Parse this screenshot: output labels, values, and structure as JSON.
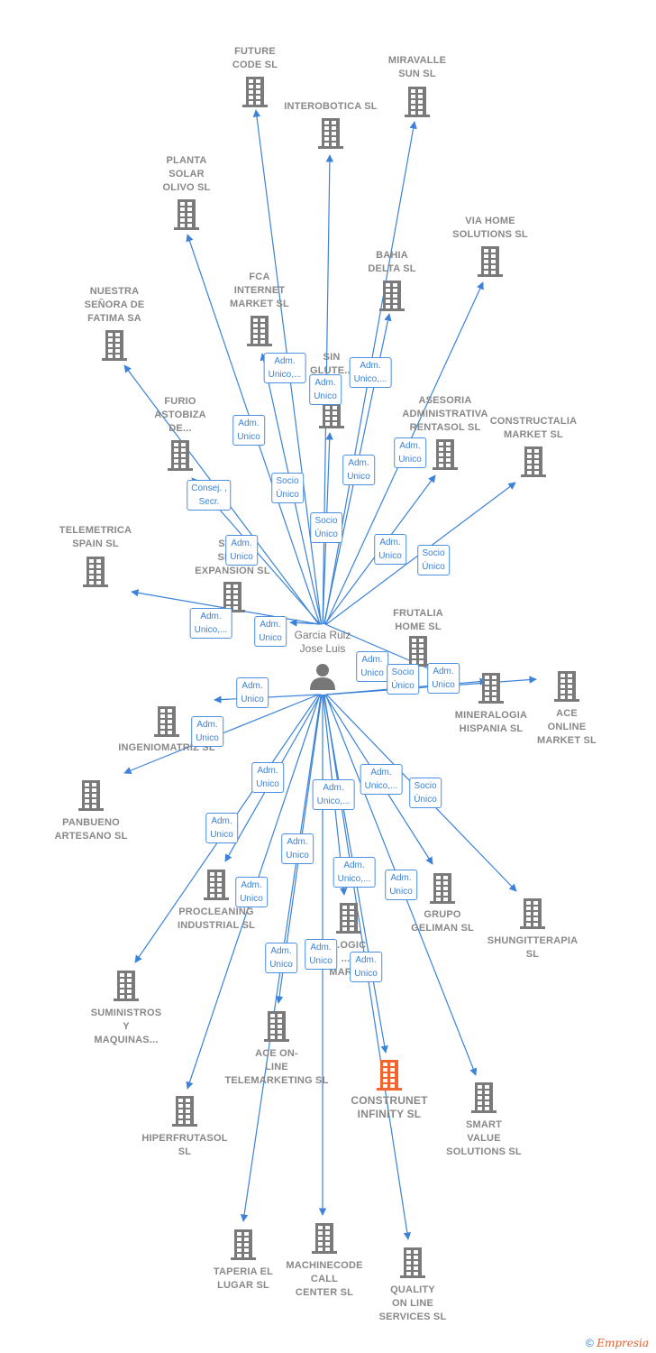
{
  "colors": {
    "edge": "#3b82d8",
    "node": "#7a7a7a",
    "highlight": "#f26430"
  },
  "hub": {
    "name": "Garcia Ruiz\nJose Luis",
    "icon": "person-icon"
  },
  "nodes": [
    {
      "name": "FUTURE\nCODE  SL"
    },
    {
      "name": "MIRAVALLE\nSUN  SL"
    },
    {
      "name": "INTEROBOTICA SL"
    },
    {
      "name": "PLANTA\nSOLAR\nOLIVO SL"
    },
    {
      "name": "VIA HOME\nSOLUTIONS SL"
    },
    {
      "name": "BAHIA\nDELTA SL"
    },
    {
      "name": "NUESTRA\nSEÑORA DE\nFATIMA SA"
    },
    {
      "name": "FCA\nINTERNET\nMARKET  SL"
    },
    {
      "name": "SIN\nGLUTE...\nM..."
    },
    {
      "name": "FURIO\nASTOBIZA\nDE..."
    },
    {
      "name": "ASESORIA\nADMINISTRATIVA\nRENTASOL SL"
    },
    {
      "name": "CONSTRUCTALIA\nMARKET  SL"
    },
    {
      "name": "TELEMETRICA\nSPAIN  SL"
    },
    {
      "name": "STA...\nSER...\nEXPANSION SL"
    },
    {
      "name": "FRUTALIA\nHOME  SL"
    },
    {
      "name": "MINERALOGIA\nHISPANIA  SL"
    },
    {
      "name": "ACE\nONLINE\nMARKET SL"
    },
    {
      "name": "INGENIOMATRIZ SL"
    },
    {
      "name": "PANBUENO\nARTESANO  SL"
    },
    {
      "name": "PROCLEANING\nINDUSTRIAL SL"
    },
    {
      "name": "GRUPO\nGELIMAN  SL"
    },
    {
      "name": "SHUNGITTERAPIA\nSL"
    },
    {
      "name": "...OGIC\n...T\nMARK..."
    },
    {
      "name": "SUMINISTROS\nY\nMAQUINAS..."
    },
    {
      "name": "ACE ON-\nLINE\nTELEMARKETING SL"
    },
    {
      "name": "CONSTRUNET\nINFINITY  SL",
      "highlight": true
    },
    {
      "name": "SMART\nVALUE\nSOLUTIONS SL"
    },
    {
      "name": "HIPERFRUTASOL\nSL"
    },
    {
      "name": "TAPERIA EL\nLUGAR SL"
    },
    {
      "name": "MACHINECODE\nCALL\nCENTER  SL"
    },
    {
      "name": "QUALITY\nON LINE\nSERVICES  SL"
    }
  ],
  "edge_labels": [
    "Adm.\nUnico,...",
    "Adm.\nUnico",
    "Adm.\nUnico,...",
    "Adm.\nUnico",
    "Adm.\nUnico",
    "Adm.\nUnico",
    "Socio\nÚnico",
    "Consej. ,\nSecr.",
    "Socio\nÚnico",
    "Adm.\nUnico",
    "Adm.\nUnico",
    "Socio\nÚnico",
    "Adm.\nUnico,...",
    "Adm.\nUnico",
    "Adm.\nUnico",
    "Socio\nÚnico",
    "Adm.\nUnico",
    "Adm.\nUnico",
    "Adm.\nUnico",
    "Adm.\nUnico",
    "Adm.\nUnico,...",
    "Adm.\nUnico,...",
    "Socio\nÚnico",
    "Adm.\nUnico",
    "Adm.\nUnico",
    "Adm.\nUnico,...",
    "Adm.\nUnico",
    "Adm.\nUnico",
    "Adm.\nUnico",
    "Adm.\nUnico",
    "Adm.\nUnico"
  ],
  "footer": {
    "copyright": "©",
    "brand": "Empresia"
  }
}
